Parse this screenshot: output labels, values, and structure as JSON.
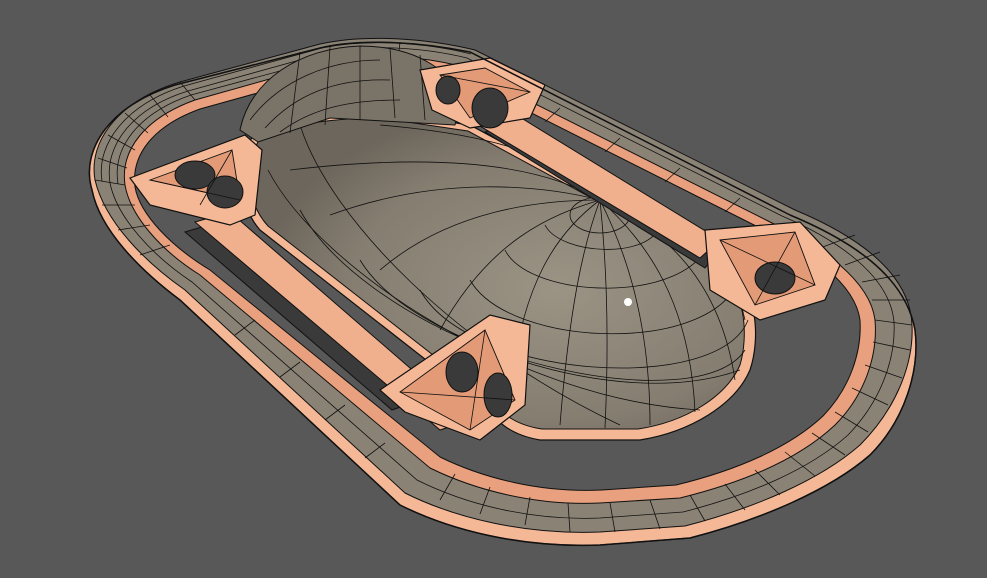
{
  "scene": {
    "description_free": true,
    "colors": {
      "background": "#585858",
      "frame_light": "#f4b896",
      "frame_mid": "#e8a07e",
      "frame_dark": "#c97b5c",
      "dome": "#8a8275",
      "dome_shadow": "#6e685e",
      "slot": "#3a3a3a",
      "wire": "#111111",
      "highlight": "#ffffff"
    },
    "icons": [
      "wireframe-model",
      "specular-highlight"
    ]
  }
}
